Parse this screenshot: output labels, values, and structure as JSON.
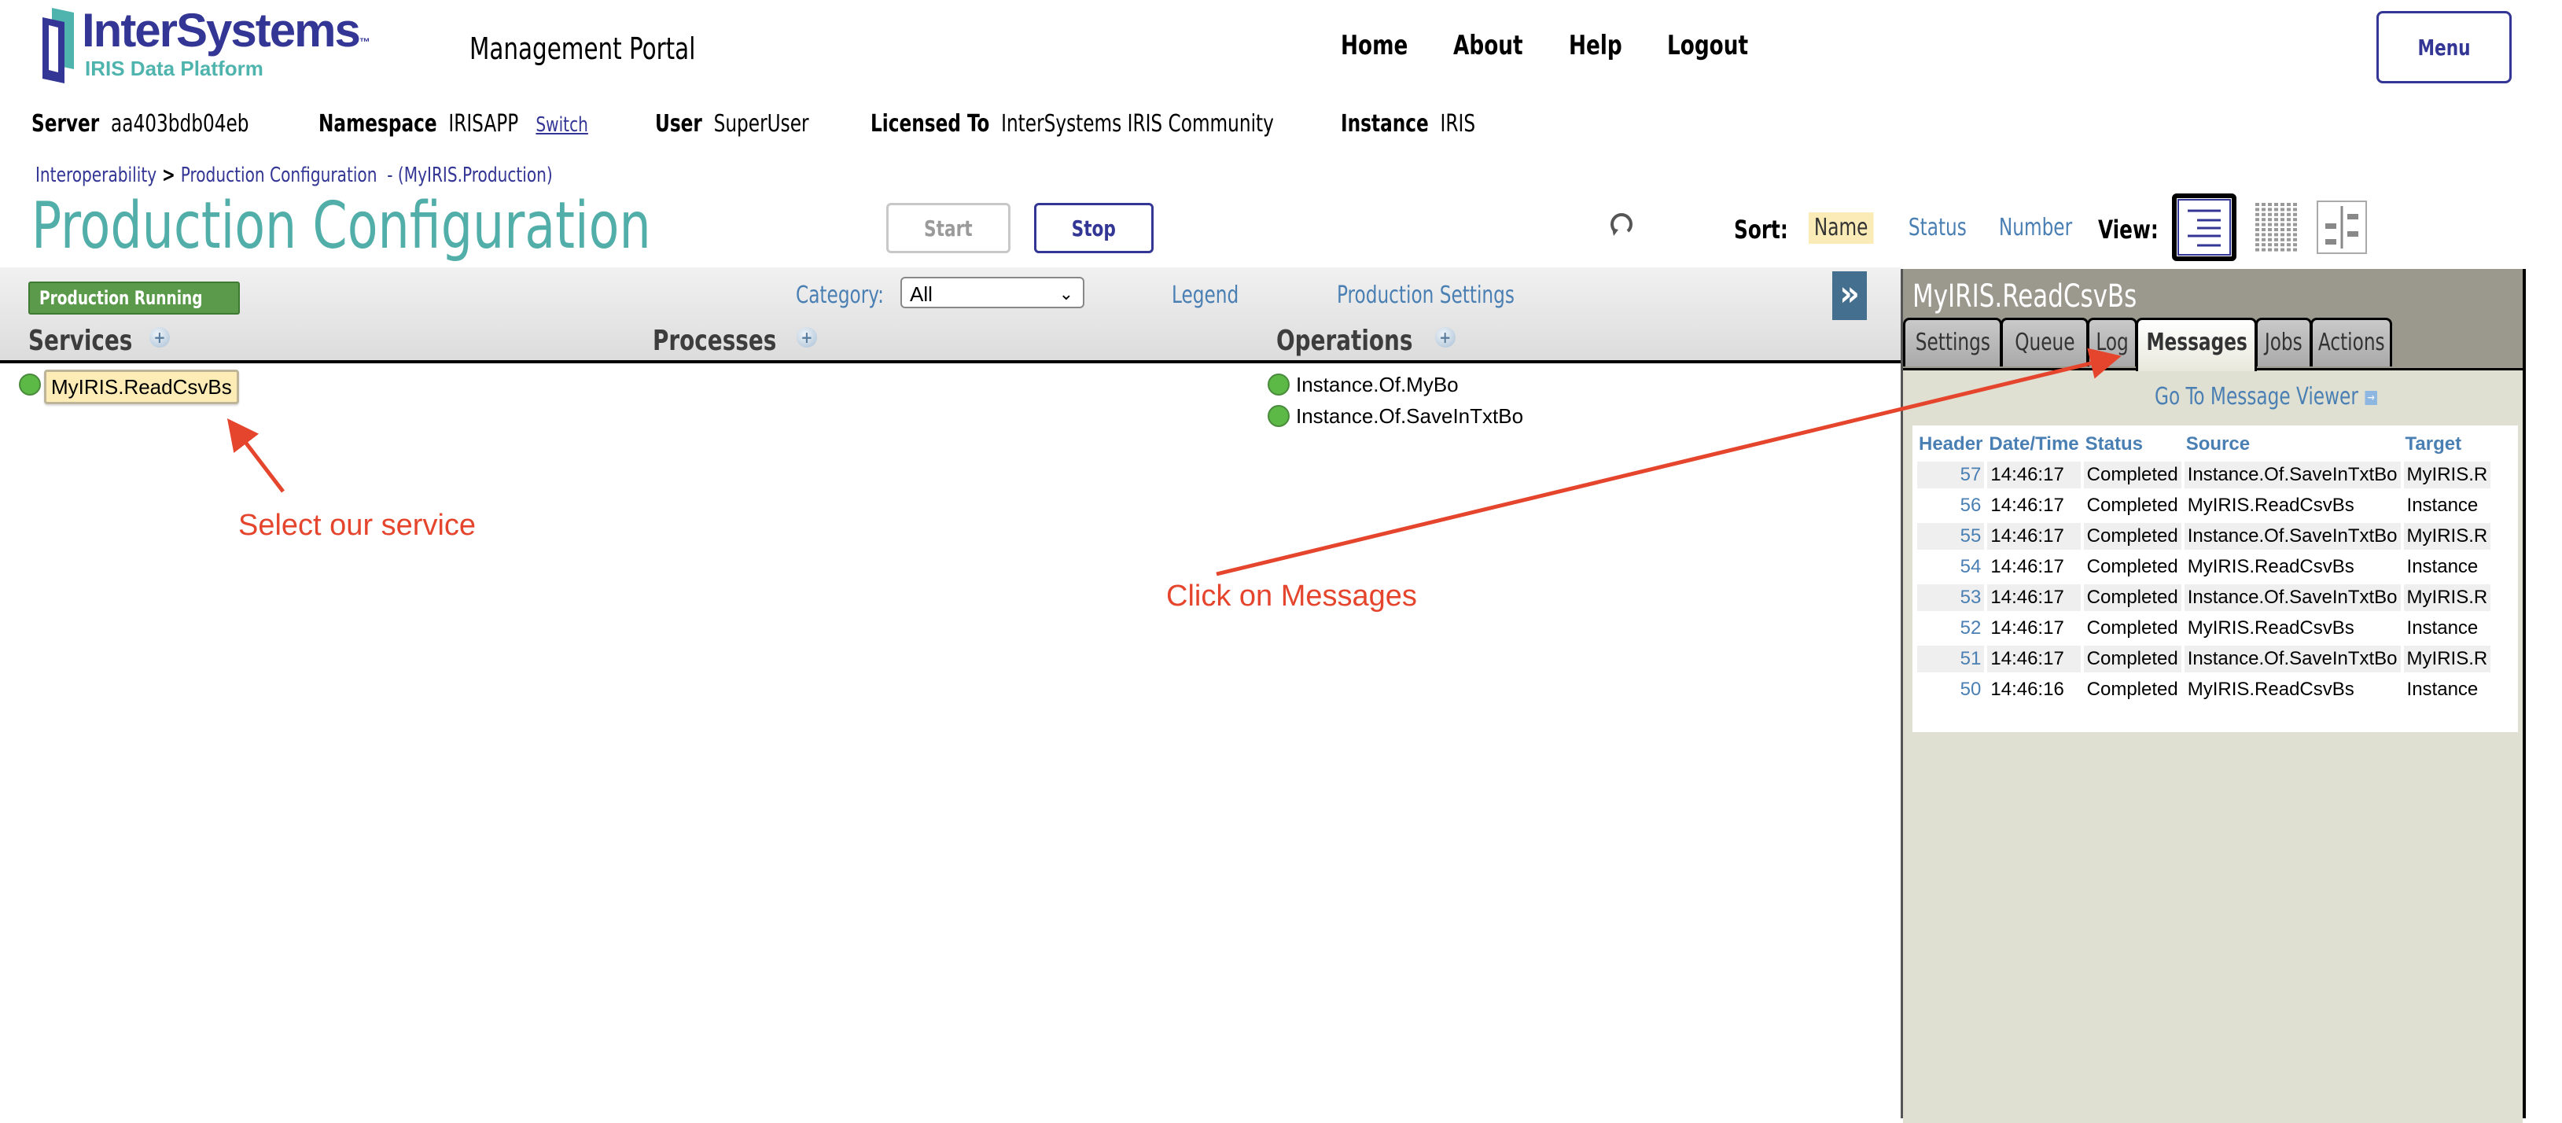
{
  "header": {
    "logo_text": "InterSystems",
    "logo_tm": "™",
    "logo_subtitle": "IRIS Data Platform",
    "portal_title": "Management Portal",
    "nav": [
      "Home",
      "About",
      "Help",
      "Logout"
    ],
    "menu_label": "Menu",
    "info": {
      "server_label": "Server",
      "server_value": "aa403bdb04eb",
      "namespace_label": "Namespace",
      "namespace_value": "IRISAPP",
      "switch_label": "Switch",
      "user_label": "User",
      "user_value": "SuperUser",
      "licensed_label": "Licensed To",
      "licensed_value": "InterSystems IRIS Community",
      "instance_label": "Instance",
      "instance_value": "IRIS"
    }
  },
  "breadcrumb": {
    "items": [
      "Interoperability",
      "Production Configuration"
    ],
    "separator": ">",
    "suffix": "- (MyIRIS.Production)"
  },
  "page": {
    "title": "Production Configuration",
    "start_label": "Start",
    "stop_label": "Stop",
    "sort_label": "Sort:",
    "sort_options": [
      "Name",
      "Status",
      "Number"
    ],
    "sort_selected": "Name",
    "view_label": "View:",
    "view_options": [
      "list-view",
      "grid-view",
      "hierarchy-view"
    ],
    "view_selected": "list-view"
  },
  "toolbar": {
    "status_badge": "Production Running",
    "category_label": "Category:",
    "category_value": "All",
    "legend_link": "Legend",
    "settings_link": "Production Settings",
    "collapse_label": "»"
  },
  "columns": {
    "services": {
      "title": "Services",
      "items": [
        {
          "name": "MyIRIS.ReadCsvBs",
          "status": "running",
          "selected": true
        }
      ]
    },
    "processes": {
      "title": "Processes",
      "items": []
    },
    "operations": {
      "title": "Operations",
      "items": [
        {
          "name": "Instance.Of.MyBo",
          "status": "running"
        },
        {
          "name": "Instance.Of.SaveInTxtBo",
          "status": "running"
        }
      ]
    }
  },
  "panel": {
    "title": "MyIRIS.ReadCsvBs",
    "tabs": [
      "Settings",
      "Queue",
      "Log",
      "Messages",
      "Jobs",
      "Actions"
    ],
    "active_tab": "Messages",
    "goto_label": "Go To Message Viewer",
    "table": {
      "headers": [
        "Header",
        "Date/Time",
        "Status",
        "Source",
        "Target"
      ],
      "rows": [
        [
          "57",
          "14:46:17",
          "Completed",
          "Instance.Of.SaveInTxtBo",
          "MyIRIS.R"
        ],
        [
          "56",
          "14:46:17",
          "Completed",
          "MyIRIS.ReadCsvBs",
          "Instance"
        ],
        [
          "55",
          "14:46:17",
          "Completed",
          "Instance.Of.SaveInTxtBo",
          "MyIRIS.R"
        ],
        [
          "54",
          "14:46:17",
          "Completed",
          "MyIRIS.ReadCsvBs",
          "Instance"
        ],
        [
          "53",
          "14:46:17",
          "Completed",
          "Instance.Of.SaveInTxtBo",
          "MyIRIS.R"
        ],
        [
          "52",
          "14:46:17",
          "Completed",
          "MyIRIS.ReadCsvBs",
          "Instance"
        ],
        [
          "51",
          "14:46:17",
          "Completed",
          "Instance.Of.SaveInTxtBo",
          "MyIRIS.R"
        ],
        [
          "50",
          "14:46:16",
          "Completed",
          "MyIRIS.ReadCsvBs",
          "Instance"
        ]
      ]
    }
  },
  "annotations": {
    "select_service": "Select our service",
    "click_messages": "Click on Messages",
    "color": "#e5452d"
  },
  "colors": {
    "brand_navy": "#333695",
    "brand_teal": "#52aea9",
    "link_blue": "#4a7fb3",
    "status_green": "#5cb946",
    "running_badge": "#5c9a4b",
    "panel_header": "#9b988e",
    "panel_body": "#dfdfd2"
  }
}
